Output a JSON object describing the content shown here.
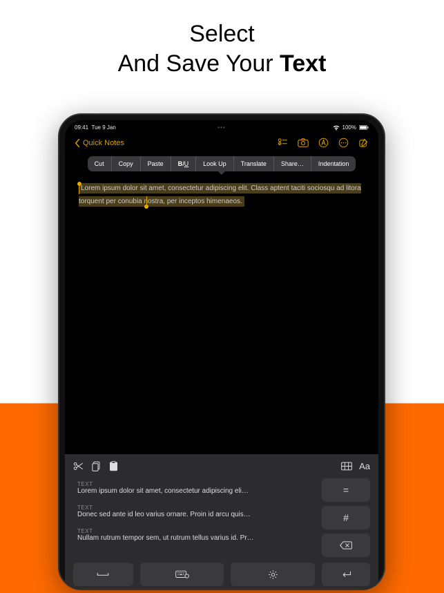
{
  "headline": {
    "line1": "Select",
    "line2_a": "And Save Your ",
    "line2_b": "Text"
  },
  "status": {
    "time": "09:41",
    "date": "Tue 9 Jan",
    "battery": "100%"
  },
  "nav": {
    "back_label": "Quick Notes"
  },
  "context_menu": {
    "cut": "Cut",
    "copy": "Copy",
    "paste": "Paste",
    "biu_b": "B",
    "biu_i": "I",
    "biu_u": "U",
    "lookup": "Look Up",
    "translate": "Translate",
    "share": "Share…",
    "indentation": "Indentation"
  },
  "note": {
    "selected": "Lorem ipsum dolor sit amet, consectetur adipiscing elit. Class aptent taciti sociosqu ad litora torquent per conubia nostra, per inceptos himenaeos."
  },
  "keyboard": {
    "aa": "Aa"
  },
  "clips": [
    {
      "label": "TEXT",
      "text": "Lorem ipsum dolor sit amet, consectetur adipiscing eli…"
    },
    {
      "label": "TEXT",
      "text": "Donec sed ante id leo varius ornare. Proin id arcu quis…"
    },
    {
      "label": "TEXT",
      "text": "Nullam rutrum tempor sem, ut rutrum tellus varius id. Pr…"
    }
  ],
  "side_keys": {
    "equals": "=",
    "hash": "#"
  }
}
